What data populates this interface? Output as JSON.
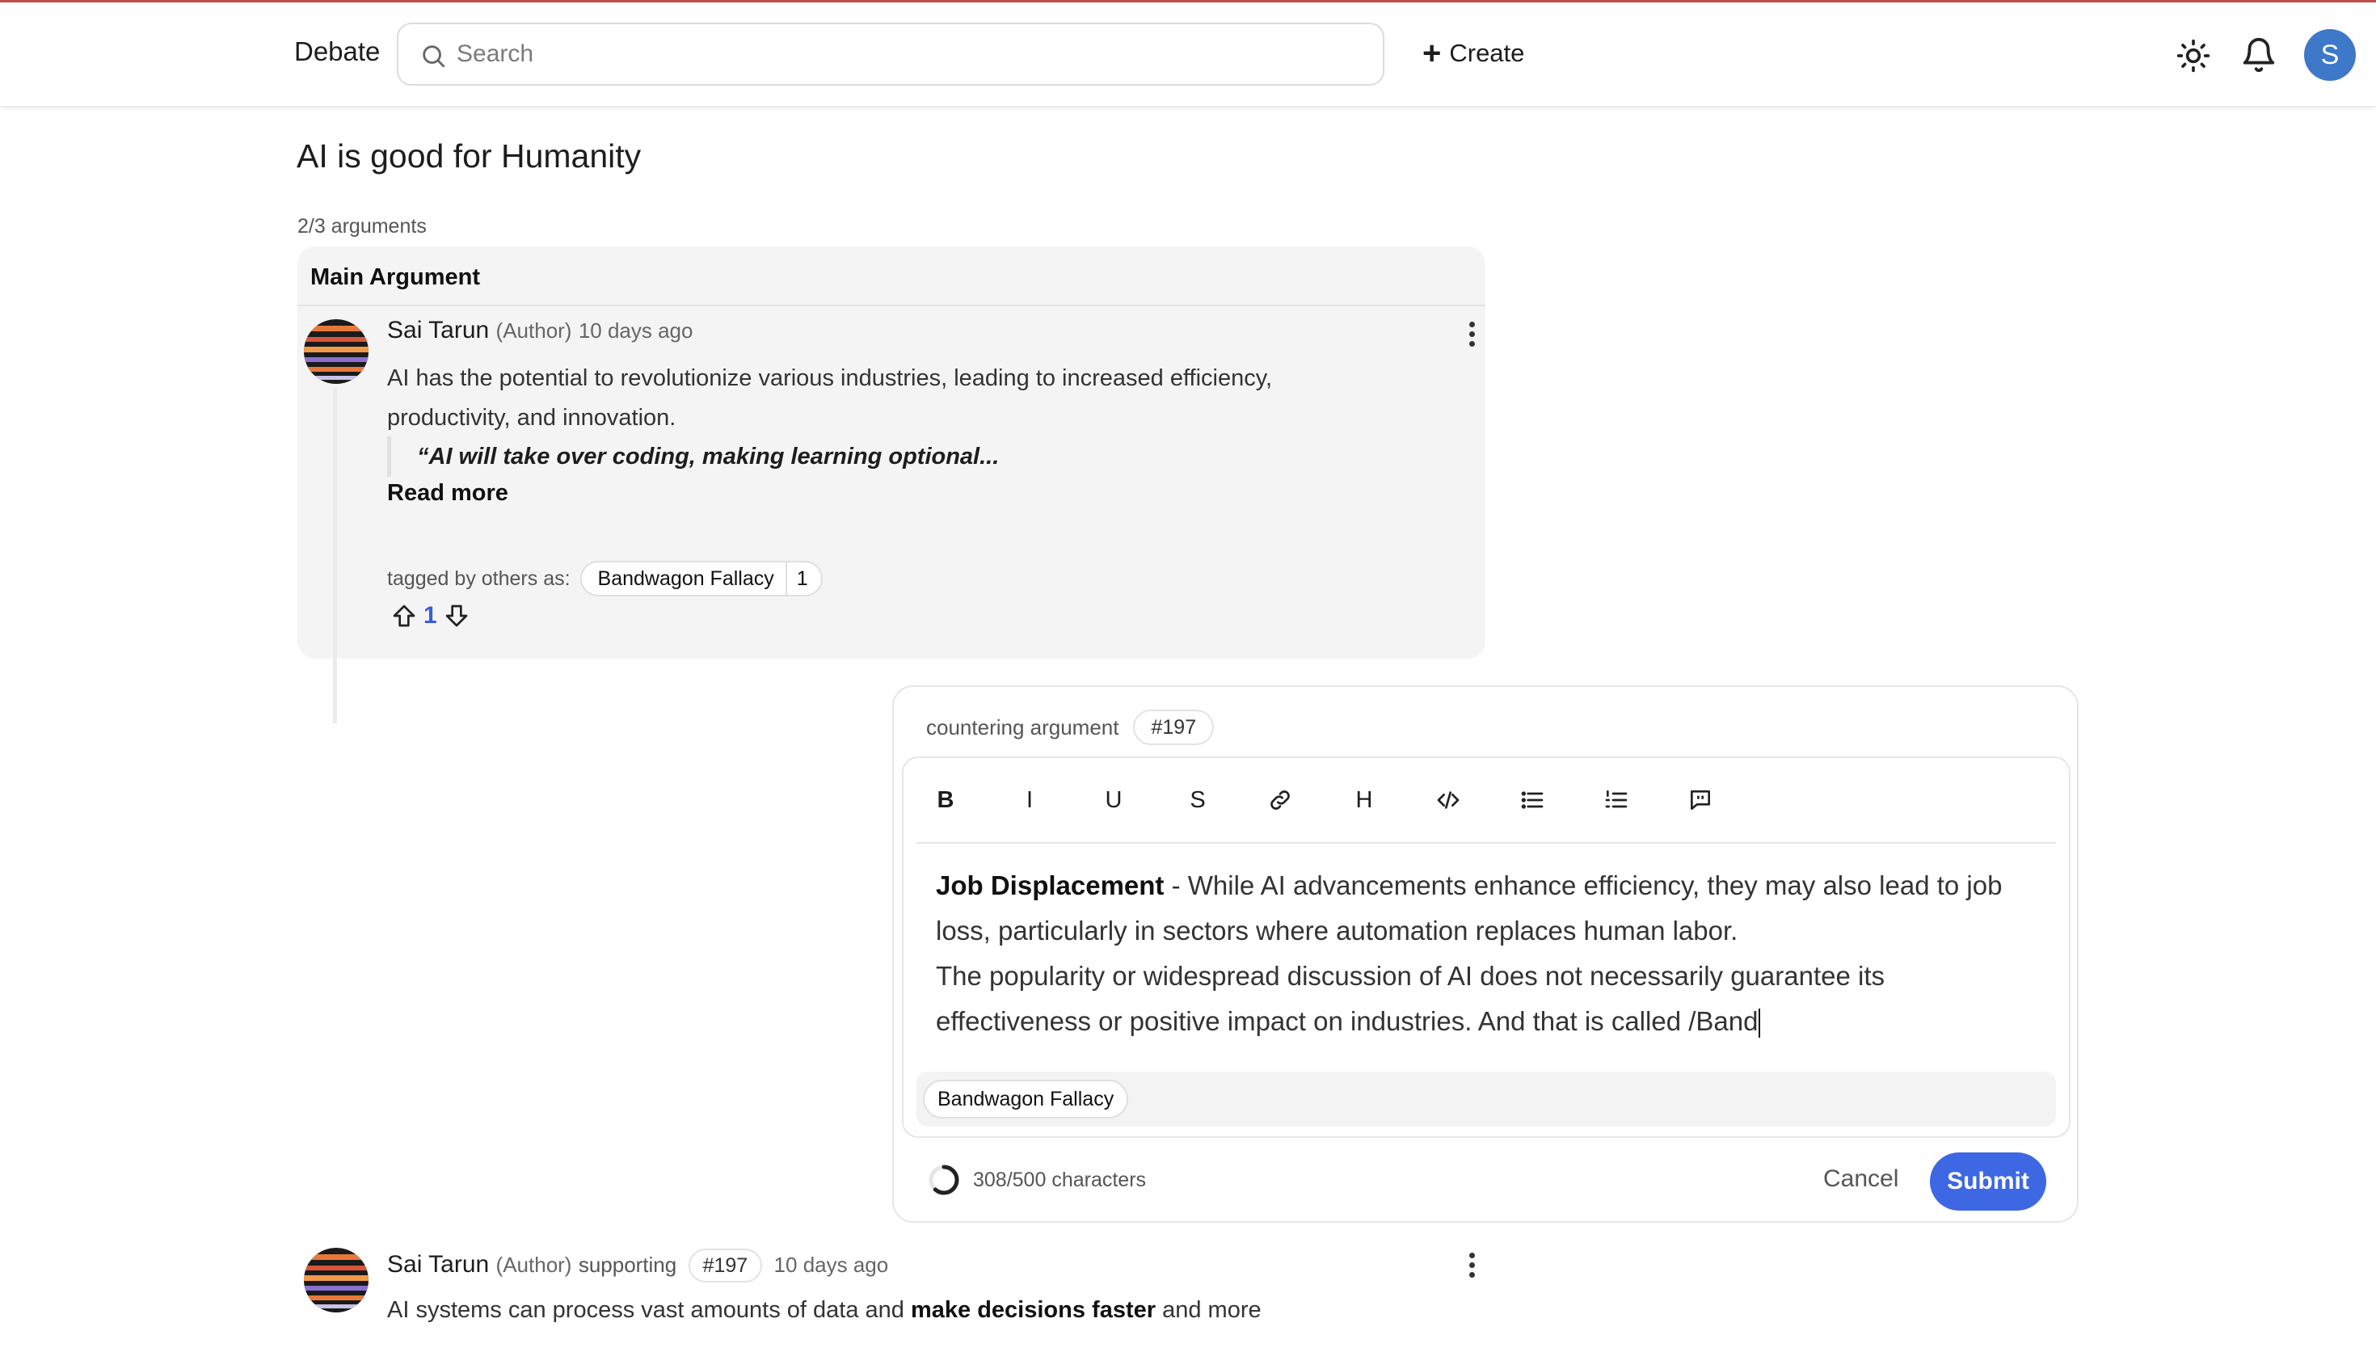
{
  "header": {
    "brand": "Debate",
    "search_placeholder": "Search",
    "create_label": "Create",
    "avatar_initial": "S",
    "icons": [
      "search-icon",
      "plus-icon",
      "sun-icon",
      "bell-icon"
    ]
  },
  "debate": {
    "title": "AI is good for Humanity",
    "argument_count": "2/3 arguments"
  },
  "main_argument": {
    "heading": "Main Argument",
    "author": "Sai Tarun",
    "author_role": "(Author)",
    "time": "10 days ago",
    "text": "AI has the potential to revolutionize various industries, leading to increased efficiency, productivity, and innovation.",
    "quote": "“AI will take over coding, making learning optional...",
    "read_more": "Read more",
    "tagged_label": "tagged by others as:",
    "tag_name": "Bandwagon Fallacy",
    "tag_count": "1",
    "votes": "1"
  },
  "composer": {
    "countering_label": "countering argument",
    "argument_id": "#197",
    "toolbar": {
      "bold": "B",
      "italic": "I",
      "underline": "U",
      "strike": "S",
      "heading": "H"
    },
    "bold_lead": "Job Displacement",
    "text_line1": " - While AI advancements enhance efficiency, they may also lead to job loss, particularly in sectors where automation replaces human labor.",
    "text_line2": "The popularity or widespread discussion of AI does not necessarily guarantee its effectiveness or positive impact on industries. And that is called /Band",
    "suggestion": "Bandwagon Fallacy",
    "char_count": "308/500 characters",
    "char_progress": 0.616,
    "cancel_label": "Cancel",
    "submit_label": "Submit"
  },
  "supporting_argument": {
    "author": "Sai Tarun",
    "author_role": "(Author)",
    "stance": "supporting",
    "argument_id": "#197",
    "time": "10 days ago",
    "text_start": "AI systems can process vast amounts of data and ",
    "text_bold": "make decisions faster",
    "text_end": " and more"
  },
  "colors": {
    "accent": "#3d67e3",
    "avatar_bg": "#3d78c9",
    "vote_count": "#3b5bdb",
    "card_bg": "#f4f4f4"
  }
}
